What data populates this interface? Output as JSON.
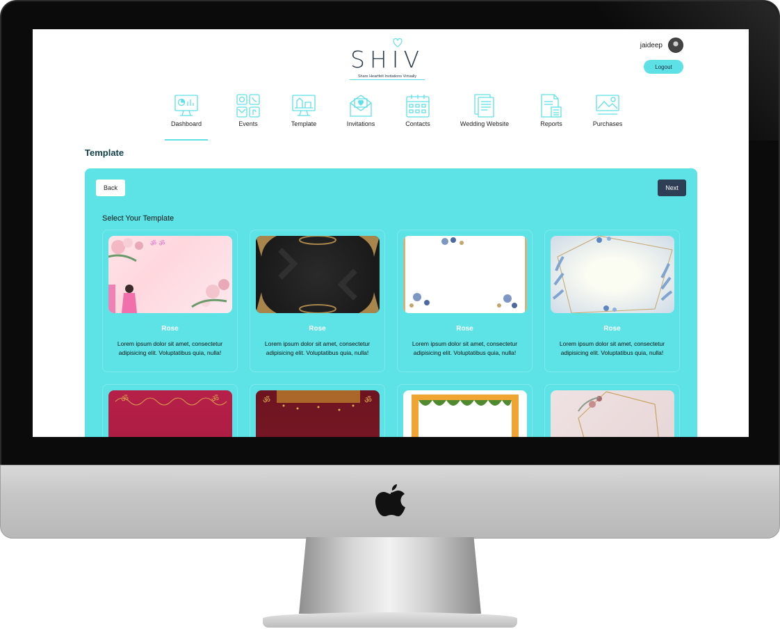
{
  "app": {
    "logo_text": "SHIV",
    "logo_tagline": "Share Heartfelt Invitations Virtually"
  },
  "user": {
    "name": "jaideep",
    "logout_label": "Logout"
  },
  "nav": {
    "items": [
      {
        "label": "Dashboard",
        "icon": "dashboard-icon",
        "active": true
      },
      {
        "label": "Events",
        "icon": "events-icon"
      },
      {
        "label": "Template",
        "icon": "template-icon"
      },
      {
        "label": "Invitations",
        "icon": "invitation-envelope-icon"
      },
      {
        "label": "Contacts",
        "icon": "contacts-calendar-icon"
      },
      {
        "label": "Wedding Website",
        "icon": "wedding-website-icon"
      },
      {
        "label": "Reports",
        "icon": "reports-icon"
      },
      {
        "label": "Purchases",
        "icon": "purchases-icon"
      }
    ]
  },
  "page": {
    "title": "Template",
    "back_label": "Back",
    "next_label": "Next",
    "select_title": "Select Your Template"
  },
  "templates": [
    {
      "name": "Rose",
      "desc": "Lorem ipsum dolor sit amet, consectetur adipisicing elit. Voluptatibus quia, nulla!"
    },
    {
      "name": "Rose",
      "desc": "Lorem ipsum dolor sit amet, consectetur adipisicing elit. Voluptatibus quia, nulla!"
    },
    {
      "name": "Rose",
      "desc": "Lorem ipsum dolor sit amet, consectetur adipisicing elit. Voluptatibus quia, nulla!"
    },
    {
      "name": "Rose",
      "desc": "Lorem ipsum dolor sit amet, consectetur adipisicing elit. Voluptatibus quia, nulla!"
    }
  ],
  "colors": {
    "accent": "#5de3e6",
    "dark_button": "#2e3e55",
    "title": "#0f3f4a"
  }
}
